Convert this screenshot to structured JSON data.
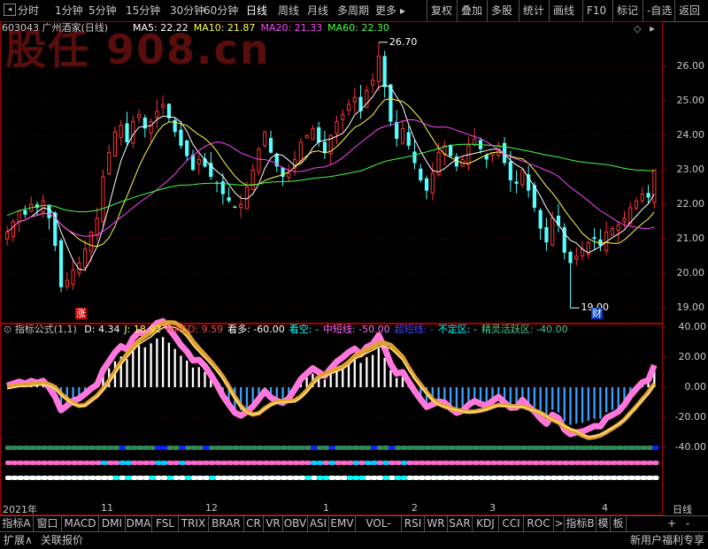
{
  "toolbar": {
    "left_buttons": [
      "分时",
      "1分钟",
      "5分钟",
      "15分钟",
      "30分钟",
      "60分钟",
      "日线",
      "周线",
      "月线",
      "多周期",
      "更多"
    ],
    "more_arrow": "▸",
    "right_buttons": [
      "复权",
      "叠加",
      "多股",
      "统计",
      "画线",
      "F10",
      "标记",
      "-自选",
      "返回"
    ]
  },
  "stock": {
    "code": "603043",
    "name": "广州酒家",
    "period": "(日线)"
  },
  "watermark": "股任 908.cn",
  "ma_legend": [
    {
      "label": "MA5: 22.22",
      "color": "#ffffff"
    },
    {
      "label": "MA10: 21.87",
      "color": "#ffff44"
    },
    {
      "label": "MA20: 21.33",
      "color": "#ff44ff"
    },
    {
      "label": "MA60: 22.30",
      "color": "#44ff44"
    }
  ],
  "price_axis": [
    "26.00",
    "25.00",
    "24.00",
    "23.00",
    "22.00",
    "21.00",
    "20.00",
    "19.00"
  ],
  "annotations": {
    "high": "26.70",
    "low": "19.00",
    "zhang": "涨",
    "cai": "财"
  },
  "indicator": {
    "title": "指标公式(1,1)",
    "items": [
      {
        "label": "D: 4.34",
        "color": "#ffffff"
      },
      {
        "label": "J: 18.92",
        "color": "#ffff44"
      },
      {
        "label": "MACD: 9.59",
        "color": "#ff4444"
      },
      {
        "label": "看多: -60.00",
        "color": "#ffffff"
      },
      {
        "label": "看空: -",
        "color": "#00ffff"
      },
      {
        "label": "中短线: -50.00",
        "color": "#ff66ff"
      },
      {
        "label": "超短线: -",
        "color": "#4444ff"
      },
      {
        "label": "不定区: -",
        "color": "#00ffff"
      },
      {
        "label": "精灵活跃区: -40.00",
        "color": "#44cc88"
      }
    ],
    "axis": [
      "40.00",
      "20.00",
      "0.00",
      "-20.00",
      "-40.00"
    ]
  },
  "date_axis": [
    {
      "label": "2021年"
    },
    {
      "label": "11"
    },
    {
      "label": "12"
    },
    {
      "label": "1"
    },
    {
      "label": "2"
    },
    {
      "label": "3"
    },
    {
      "label": "4"
    }
  ],
  "period_label": "日线",
  "tabs": [
    "指标A",
    "窗口",
    "MACD",
    "DMI",
    "DMA",
    "FSL",
    "TRIX",
    "BRAR",
    "CR",
    "VR",
    "OBV",
    "ASI",
    "EMV",
    "VOL-TDX",
    "RSI",
    "WR",
    "SAR",
    "KDJ",
    "CCI",
    "ROC",
    ">",
    "指标B",
    "模",
    "板"
  ],
  "status": {
    "left": [
      "扩展∧",
      "关联报价"
    ],
    "right": "新用户福利专享"
  },
  "chart_data": {
    "type": "candlestick",
    "title": "603043 广州酒家 (日线)",
    "price_range": [
      18.7,
      26.9
    ],
    "high": 26.7,
    "low": 19.0,
    "closes": [
      21.2,
      21.5,
      21.8,
      21.7,
      22.0,
      21.9,
      22.1,
      21.6,
      20.8,
      19.6,
      19.8,
      20.1,
      20.3,
      20.7,
      21.2,
      21.6,
      22.8,
      23.5,
      24.1,
      24.3,
      23.8,
      24.4,
      24.6,
      24.2,
      24.4,
      24.7,
      24.9,
      24.5,
      24.1,
      23.7,
      23.4,
      23.0,
      23.3,
      23.1,
      22.8,
      22.6,
      22.3,
      22.1,
      21.9,
      22.0,
      22.5,
      23.0,
      23.6,
      24.1,
      23.5,
      23.1,
      22.8,
      22.9,
      23.3,
      23.8,
      24.0,
      24.2,
      23.8,
      23.5,
      24.0,
      24.4,
      24.6,
      24.9,
      25.1,
      24.7,
      25.3,
      25.6,
      26.3,
      25.4,
      24.4,
      23.9,
      24.2,
      23.7,
      23.2,
      22.7,
      22.4,
      22.9,
      23.5,
      23.7,
      23.4,
      23.1,
      23.3,
      23.7,
      23.9,
      23.6,
      23.3,
      23.5,
      23.7,
      23.2,
      22.7,
      22.6,
      23.0,
      22.4,
      21.9,
      21.3,
      20.9,
      21.6,
      21.4,
      20.6,
      20.3,
      20.5,
      20.7,
      20.9,
      21.0,
      20.8,
      21.2,
      21.3,
      21.4,
      21.6,
      21.9,
      22.1,
      22.3,
      22.2,
      23.0
    ]
  }
}
